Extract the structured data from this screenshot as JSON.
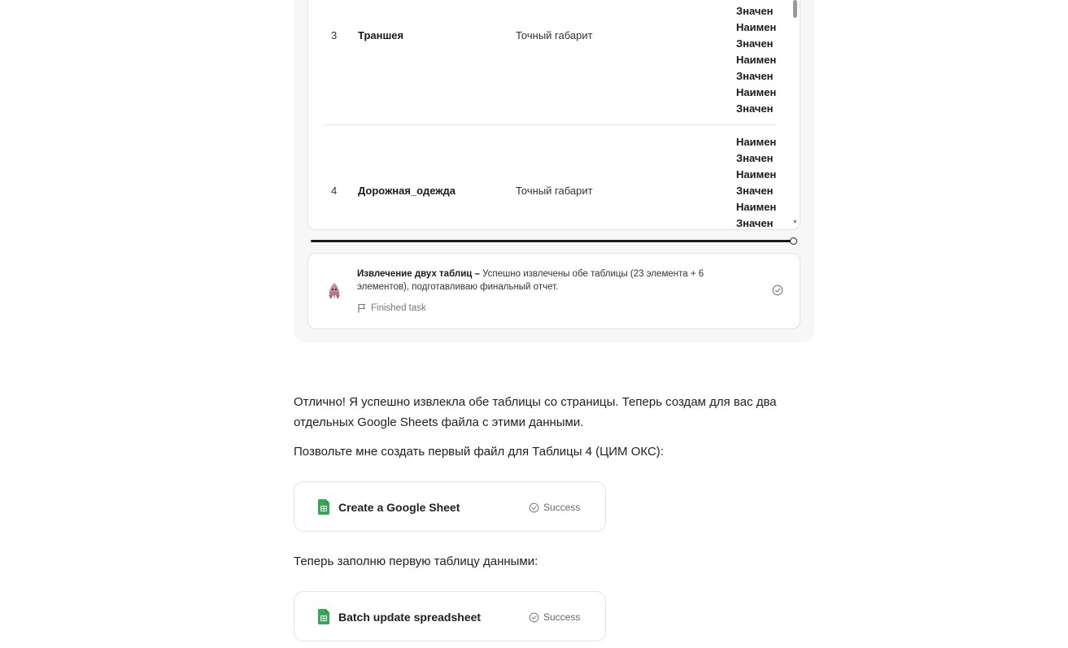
{
  "table": {
    "rows": [
      {
        "num": "3",
        "name": "Траншея",
        "type": "Точный габарит",
        "values": [
          "Значен",
          "Наимен",
          "Значен",
          "Наимен",
          "Значен",
          "Наимен",
          "Значен"
        ]
      },
      {
        "num": "4",
        "name": "Дорожная_одежда",
        "type": "Точный габарит",
        "values": [
          "Наимен",
          "Значен",
          "Наимен",
          "Значен",
          "Наимен",
          "Значен"
        ]
      }
    ]
  },
  "step": {
    "title": "Извлечение двух таблиц",
    "separator": " – ",
    "description": "Успешно извлечены обе таблицы (23 элемента + 6 элементов), подготавливаю финальный отчет.",
    "finished_label": "Finished task"
  },
  "messages": {
    "m1": "Отлично! Я успешно извлекла обе таблицы со страницы. Теперь создам для вас два отдельных Google Sheets файла с этими данными.",
    "m2": "Позвольте мне создать первый файл для Таблицы 4 (ЦИМ ОКС):",
    "m3": "Теперь заполню первую таблицу данными:"
  },
  "tools": [
    {
      "name": "Create a Google Sheet",
      "status": "Success"
    },
    {
      "name": "Batch update spreadsheet",
      "status": "Success"
    }
  ],
  "colors": {
    "sheets_green": "#34a853",
    "panel_bg": "#f7f7f7"
  }
}
